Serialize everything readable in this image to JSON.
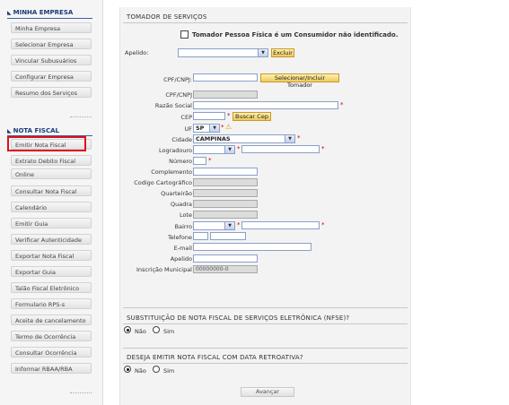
{
  "sidebar": {
    "empresa_title": "MINHA EMPRESA",
    "empresa_items": [
      "Minha Empresa",
      "Selecionar Empresa",
      "Vincular Subusuários",
      "Configurar Empresa",
      "Resumo dos Serviços"
    ],
    "nota_title": "NOTA FISCAL",
    "nota_items": [
      "Emitir Nota Fiscal",
      "Extrato Debito Fiscal",
      "Online",
      "Consultar Nota Fiscal",
      "Calendário",
      "Emitir Guia",
      "Verificar Autenticidade",
      "Exportar Nota Fiscal",
      "Exportar Guia",
      "Talão Fiscal Eletrônico",
      "Formulario RPS-s",
      "Aceite de cancelamento",
      "Termo de Ocorrência",
      "Consultar Ocorrência",
      "Informar RBAA/RBA"
    ],
    "highlighted_item": "Emitir Nota Fiscal"
  },
  "tomador": {
    "section_title": "TOMADOR DE SERVIÇOS",
    "checkbox_label": "Tomador Pessoa Física é um Consumidor não identificado.",
    "apelido_label": "Apelido:",
    "excluir_label": "Excluir",
    "cpf_search_label": "CPF/CNPJ:",
    "selecionar_label": "Selecionar/Incluir Tomador",
    "fields": {
      "cpf": "CPF/CNPJ",
      "razao": "Razão Social",
      "cep": "CEP",
      "buscar_cep": "Buscar Cep",
      "uf": "UF",
      "uf_value": "SP",
      "cidade": "Cidade",
      "cidade_value": "CAMPINAS",
      "logradouro": "Logradouro",
      "numero": "Número",
      "complemento": "Complemento",
      "codigo": "Codigo Cartográfico",
      "quarteirao": "Quarteirão",
      "quadra": "Quadra",
      "lote": "Lote",
      "bairro": "Bairro",
      "telefone": "Telefone",
      "email": "E-mail",
      "apelido": "Apelido",
      "inscricao": "Inscrição Municipal",
      "inscricao_value": "00000000-0"
    }
  },
  "substituicao": {
    "title": "SUBSTITUIÇÃO DE NOTA FISCAL DE SERVIÇOS ELETRÔNICA (NFSE)?",
    "nao": "Não",
    "sim": "Sim"
  },
  "retroativa": {
    "title": "DESEJA EMITIR NOTA FISCAL COM DATA RETROATIVA?",
    "nao": "Não",
    "sim": "Sim"
  },
  "avancar_label": "Avançar",
  "colors": {
    "accent": "#1a3a7a",
    "highlight": "#e0101a",
    "button": "#f0c85a"
  }
}
